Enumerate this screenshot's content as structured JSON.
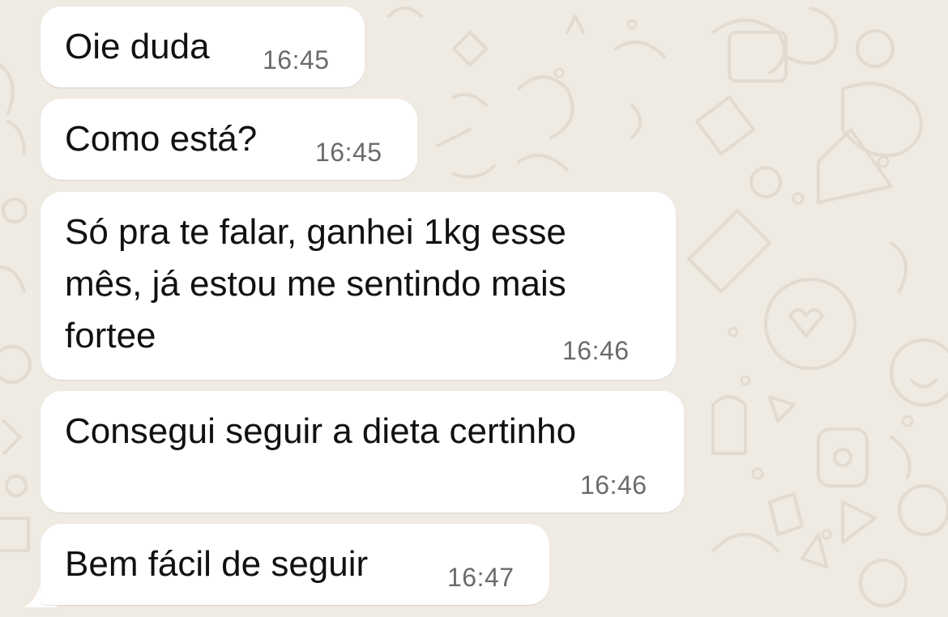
{
  "colors": {
    "background": "#efeae2",
    "bubble": "#ffffff",
    "message_text": "#111111",
    "timestamp_text": "#6b6b6b",
    "doodle": "#e4ddd2"
  },
  "messages": [
    {
      "text": "Oie duda",
      "time": "16:45"
    },
    {
      "text": "Como está?",
      "time": "16:45"
    },
    {
      "text": "Só pra te falar, ganhei 1kg esse\nmês, já estou me sentindo mais\nfortee",
      "time": "16:46"
    },
    {
      "text": "Consegui seguir a dieta certinho",
      "time": "16:46"
    },
    {
      "text": "Bem fácil de seguir",
      "time": "16:47"
    }
  ]
}
